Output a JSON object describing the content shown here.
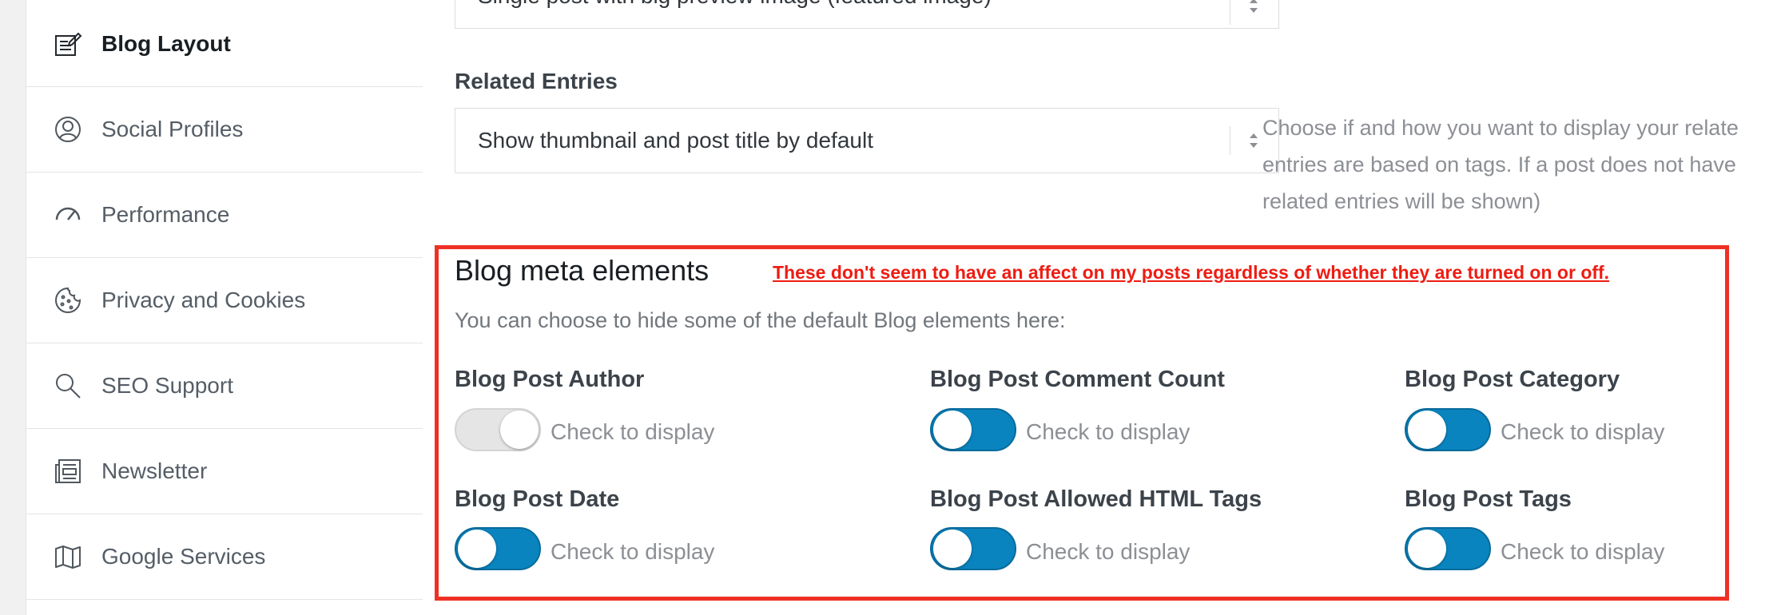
{
  "sidebar": {
    "items": [
      {
        "label": "Blog Layout",
        "icon": "blog-layout-icon",
        "active": true
      },
      {
        "label": "Social Profiles",
        "icon": "social-profiles-icon",
        "active": false
      },
      {
        "label": "Performance",
        "icon": "performance-gauge-icon",
        "active": false
      },
      {
        "label": "Privacy and Cookies",
        "icon": "cookie-icon",
        "active": false
      },
      {
        "label": "SEO Support",
        "icon": "search-icon",
        "active": false
      },
      {
        "label": "Newsletter",
        "icon": "newsletter-icon",
        "active": false
      },
      {
        "label": "Google Services",
        "icon": "map-icon",
        "active": false
      }
    ]
  },
  "main": {
    "top_select_value": "Single post with big preview image (featured image)",
    "related_entries": {
      "label": "Related Entries",
      "value": "Show thumbnail and post title by default",
      "description_lines": [
        "Choose if and how you want to display your relate",
        "entries are based on tags. If a post does not have",
        "related entries will be shown)"
      ]
    },
    "meta": {
      "title": "Blog meta elements",
      "subtitle": "You can choose to hide some of the default Blog elements here:",
      "options": [
        {
          "label": "Blog Post Author",
          "check_text": "Check to display",
          "checked": false
        },
        {
          "label": "Blog Post Comment Count",
          "check_text": "Check to display",
          "checked": true
        },
        {
          "label": "Blog Post Category",
          "check_text": "Check to display",
          "checked": true
        },
        {
          "label": "Blog Post Date",
          "check_text": "Check to display",
          "checked": true
        },
        {
          "label": "Blog Post Allowed HTML Tags",
          "check_text": "Check to display",
          "checked": true
        },
        {
          "label": "Blog Post Tags",
          "check_text": "Check to display",
          "checked": true
        }
      ]
    }
  },
  "annotation": {
    "text": "These don't seem to have an affect on my posts regardless of whether they are turned on or off.",
    "color": "#ee1c12"
  },
  "colors": {
    "toggle_on": "#0a84bf",
    "toggle_off": "#e5e5e5",
    "annotation_border": "#ee3124"
  }
}
